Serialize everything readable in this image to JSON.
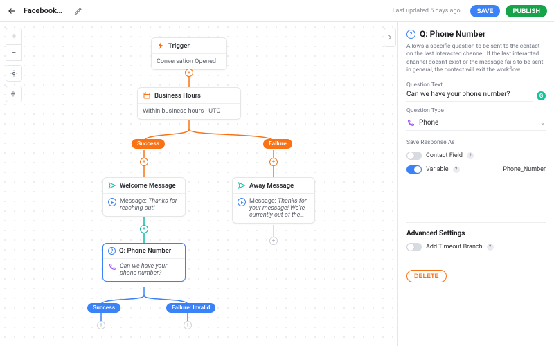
{
  "topbar": {
    "title": "Facebook…",
    "status": "Last updated 5 days ago",
    "save": "SAVE",
    "publish": "PUBLISH"
  },
  "nodes": {
    "trigger": {
      "title": "Trigger",
      "body": "Conversation Opened"
    },
    "bizhours": {
      "title": "Business Hours",
      "body": "Within business hours - UTC"
    },
    "welcome": {
      "title": "Welcome Message",
      "msg_label": "Message: ",
      "msg_value": "Thanks for reaching out!"
    },
    "away": {
      "title": "Away Message",
      "msg_label": "Message: ",
      "msg_value": "Thanks for your message! We're currently out of the…"
    },
    "question": {
      "title": "Q: Phone Number",
      "body": "Can we have your phone number?"
    }
  },
  "pills": {
    "bh_success": "Success",
    "bh_failure": "Failure",
    "q_success": "Success",
    "q_failure": "Failure: Invalid"
  },
  "panel": {
    "title": "Q: Phone Number",
    "desc": "Allows a specific question to be sent to the contact on the last interacted channel. If the last interacted channel doesn't exist or the message fails to be sent in general, the contact will exit the workflow.",
    "qtext_label": "Question Text",
    "qtext_value": "Can we have your phone number?",
    "qtype_label": "Question Type",
    "qtype_value": "Phone",
    "save_as_label": "Save Response As",
    "contact_field": "Contact Field",
    "variable": "Variable",
    "variable_name": "Phone_Number",
    "advanced": "Advanced Settings",
    "timeout": "Add Timeout Branch",
    "delete": "DELETE"
  }
}
